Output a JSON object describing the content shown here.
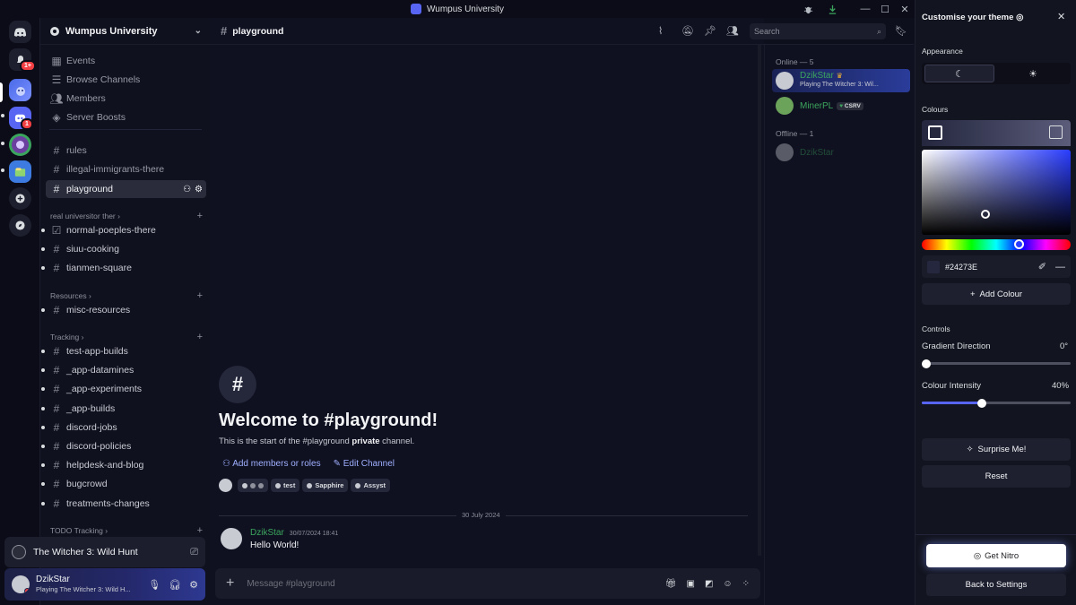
{
  "window": {
    "title": "Wumpus University"
  },
  "server": {
    "name": "Wumpus University"
  },
  "sidebar": {
    "top_items": [
      {
        "label": "Events",
        "icon": "calendar-icon"
      },
      {
        "label": "Browse Channels",
        "icon": "browse-icon"
      },
      {
        "label": "Members",
        "icon": "members-icon"
      },
      {
        "label": "Server Boosts",
        "icon": "boost-icon"
      }
    ],
    "channels": [
      "rules",
      "illegal-immigrants-there",
      "playground"
    ],
    "cat1": {
      "name": "real universitor ther",
      "channels": [
        "normal-poeples-there",
        "siuu-cooking",
        "tianmen-square"
      ]
    },
    "cat2": {
      "name": "Resources",
      "channels": [
        "misc-resources"
      ]
    },
    "cat3": {
      "name": "Tracking",
      "channels": [
        "test-app-builds",
        "_app-datamines",
        "_app-experiments",
        "_app-builds",
        "discord-jobs",
        "discord-policies",
        "helpdesk-and-blog",
        "bugcrowd",
        "treatments-changes"
      ]
    },
    "cat4": {
      "name": "TODO Tracking"
    }
  },
  "badges": {
    "mentions": "1+",
    "server_badge": "1"
  },
  "activity": {
    "game": "The Witcher 3: Wild Hunt"
  },
  "user": {
    "name": "DzikStar",
    "status": "Playing The Witcher 3: Wild H..."
  },
  "channel": {
    "name": "playground",
    "search_placeholder": "Search"
  },
  "welcome": {
    "title": "Welcome to #playground!",
    "desc_pre": "This is the start of the #playground ",
    "desc_bold": "private",
    "desc_post": " channel.",
    "add_members": "Add members or roles",
    "edit_channel": "Edit Channel",
    "tags": [
      "test",
      "Sapphire",
      "Assyst"
    ]
  },
  "divider_date": "30 July 2024",
  "message": {
    "author": "DzikStar",
    "timestamp": "30/07/2024 18:41",
    "text": "Hello World!"
  },
  "composer": {
    "placeholder": "Message #playground"
  },
  "members": {
    "online_header": "Online — 5",
    "offline_header": "Offline — 1",
    "online": [
      {
        "name": "DzikStar",
        "status": "Playing The Witcher 3: Wil..."
      },
      {
        "name": "MinerPL",
        "tag": "CSRV"
      }
    ],
    "offline": [
      {
        "name": "DzikStar"
      }
    ]
  },
  "theme": {
    "title": "Customise your theme",
    "appearance_label": "Appearance",
    "colours_label": "Colours",
    "hex": "#24273E",
    "add_colour": "Add Colour",
    "controls_label": "Controls",
    "gradient_label": "Gradient Direction",
    "gradient_value": "0°",
    "gradient_fraction": 0,
    "intensity_label": "Colour Intensity",
    "intensity_value": "40%",
    "intensity_fraction": 0.4,
    "surprise": "Surprise Me!",
    "reset": "Reset",
    "get_nitro": "Get Nitro",
    "back": "Back to Settings"
  }
}
